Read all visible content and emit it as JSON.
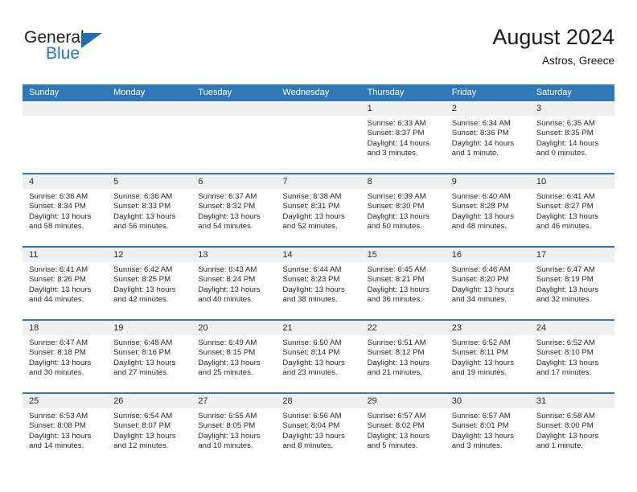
{
  "brand": {
    "name_top": "General",
    "name_bottom": "Blue",
    "triangle_color": "#1f6fb8",
    "blue_text_color": "#2079c7"
  },
  "header": {
    "title": "August 2024",
    "subtitle": "Astros, Greece"
  },
  "theme": {
    "header_blue": "#3079b8",
    "date_band_gray": "#f0f0f0",
    "text": "#2a2a2a"
  },
  "calendar": {
    "weekday_headers": [
      "Sunday",
      "Monday",
      "Tuesday",
      "Wednesday",
      "Thursday",
      "Friday",
      "Saturday"
    ],
    "weeks": [
      [
        {
          "day": "",
          "lines": []
        },
        {
          "day": "",
          "lines": []
        },
        {
          "day": "",
          "lines": []
        },
        {
          "day": "",
          "lines": []
        },
        {
          "day": "1",
          "lines": [
            "Sunrise: 6:33 AM",
            "Sunset: 8:37 PM",
            "Daylight: 14 hours",
            "and 3 minutes."
          ]
        },
        {
          "day": "2",
          "lines": [
            "Sunrise: 6:34 AM",
            "Sunset: 8:36 PM",
            "Daylight: 14 hours",
            "and 1 minute."
          ]
        },
        {
          "day": "3",
          "lines": [
            "Sunrise: 6:35 AM",
            "Sunset: 8:35 PM",
            "Daylight: 14 hours",
            "and 0 minutes."
          ]
        }
      ],
      [
        {
          "day": "4",
          "lines": [
            "Sunrise: 6:36 AM",
            "Sunset: 8:34 PM",
            "Daylight: 13 hours",
            "and 58 minutes."
          ]
        },
        {
          "day": "5",
          "lines": [
            "Sunrise: 6:36 AM",
            "Sunset: 8:33 PM",
            "Daylight: 13 hours",
            "and 56 minutes."
          ]
        },
        {
          "day": "6",
          "lines": [
            "Sunrise: 6:37 AM",
            "Sunset: 8:32 PM",
            "Daylight: 13 hours",
            "and 54 minutes."
          ]
        },
        {
          "day": "7",
          "lines": [
            "Sunrise: 6:38 AM",
            "Sunset: 8:31 PM",
            "Daylight: 13 hours",
            "and 52 minutes."
          ]
        },
        {
          "day": "8",
          "lines": [
            "Sunrise: 6:39 AM",
            "Sunset: 8:30 PM",
            "Daylight: 13 hours",
            "and 50 minutes."
          ]
        },
        {
          "day": "9",
          "lines": [
            "Sunrise: 6:40 AM",
            "Sunset: 8:28 PM",
            "Daylight: 13 hours",
            "and 48 minutes."
          ]
        },
        {
          "day": "10",
          "lines": [
            "Sunrise: 6:41 AM",
            "Sunset: 8:27 PM",
            "Daylight: 13 hours",
            "and 46 minutes."
          ]
        }
      ],
      [
        {
          "day": "11",
          "lines": [
            "Sunrise: 6:41 AM",
            "Sunset: 8:26 PM",
            "Daylight: 13 hours",
            "and 44 minutes."
          ]
        },
        {
          "day": "12",
          "lines": [
            "Sunrise: 6:42 AM",
            "Sunset: 8:25 PM",
            "Daylight: 13 hours",
            "and 42 minutes."
          ]
        },
        {
          "day": "13",
          "lines": [
            "Sunrise: 6:43 AM",
            "Sunset: 8:24 PM",
            "Daylight: 13 hours",
            "and 40 minutes."
          ]
        },
        {
          "day": "14",
          "lines": [
            "Sunrise: 6:44 AM",
            "Sunset: 8:23 PM",
            "Daylight: 13 hours",
            "and 38 minutes."
          ]
        },
        {
          "day": "15",
          "lines": [
            "Sunrise: 6:45 AM",
            "Sunset: 8:21 PM",
            "Daylight: 13 hours",
            "and 36 minutes."
          ]
        },
        {
          "day": "16",
          "lines": [
            "Sunrise: 6:46 AM",
            "Sunset: 8:20 PM",
            "Daylight: 13 hours",
            "and 34 minutes."
          ]
        },
        {
          "day": "17",
          "lines": [
            "Sunrise: 6:47 AM",
            "Sunset: 8:19 PM",
            "Daylight: 13 hours",
            "and 32 minutes."
          ]
        }
      ],
      [
        {
          "day": "18",
          "lines": [
            "Sunrise: 6:47 AM",
            "Sunset: 8:18 PM",
            "Daylight: 13 hours",
            "and 30 minutes."
          ]
        },
        {
          "day": "19",
          "lines": [
            "Sunrise: 6:48 AM",
            "Sunset: 8:16 PM",
            "Daylight: 13 hours",
            "and 27 minutes."
          ]
        },
        {
          "day": "20",
          "lines": [
            "Sunrise: 6:49 AM",
            "Sunset: 8:15 PM",
            "Daylight: 13 hours",
            "and 25 minutes."
          ]
        },
        {
          "day": "21",
          "lines": [
            "Sunrise: 6:50 AM",
            "Sunset: 8:14 PM",
            "Daylight: 13 hours",
            "and 23 minutes."
          ]
        },
        {
          "day": "22",
          "lines": [
            "Sunrise: 6:51 AM",
            "Sunset: 8:12 PM",
            "Daylight: 13 hours",
            "and 21 minutes."
          ]
        },
        {
          "day": "23",
          "lines": [
            "Sunrise: 6:52 AM",
            "Sunset: 8:11 PM",
            "Daylight: 13 hours",
            "and 19 minutes."
          ]
        },
        {
          "day": "24",
          "lines": [
            "Sunrise: 6:52 AM",
            "Sunset: 8:10 PM",
            "Daylight: 13 hours",
            "and 17 minutes."
          ]
        }
      ],
      [
        {
          "day": "25",
          "lines": [
            "Sunrise: 6:53 AM",
            "Sunset: 8:08 PM",
            "Daylight: 13 hours",
            "and 14 minutes."
          ]
        },
        {
          "day": "26",
          "lines": [
            "Sunrise: 6:54 AM",
            "Sunset: 8:07 PM",
            "Daylight: 13 hours",
            "and 12 minutes."
          ]
        },
        {
          "day": "27",
          "lines": [
            "Sunrise: 6:55 AM",
            "Sunset: 8:05 PM",
            "Daylight: 13 hours",
            "and 10 minutes."
          ]
        },
        {
          "day": "28",
          "lines": [
            "Sunrise: 6:56 AM",
            "Sunset: 8:04 PM",
            "Daylight: 13 hours",
            "and 8 minutes."
          ]
        },
        {
          "day": "29",
          "lines": [
            "Sunrise: 6:57 AM",
            "Sunset: 8:02 PM",
            "Daylight: 13 hours",
            "and 5 minutes."
          ]
        },
        {
          "day": "30",
          "lines": [
            "Sunrise: 6:57 AM",
            "Sunset: 8:01 PM",
            "Daylight: 13 hours",
            "and 3 minutes."
          ]
        },
        {
          "day": "31",
          "lines": [
            "Sunrise: 6:58 AM",
            "Sunset: 8:00 PM",
            "Daylight: 13 hours",
            "and 1 minute."
          ]
        }
      ]
    ]
  }
}
